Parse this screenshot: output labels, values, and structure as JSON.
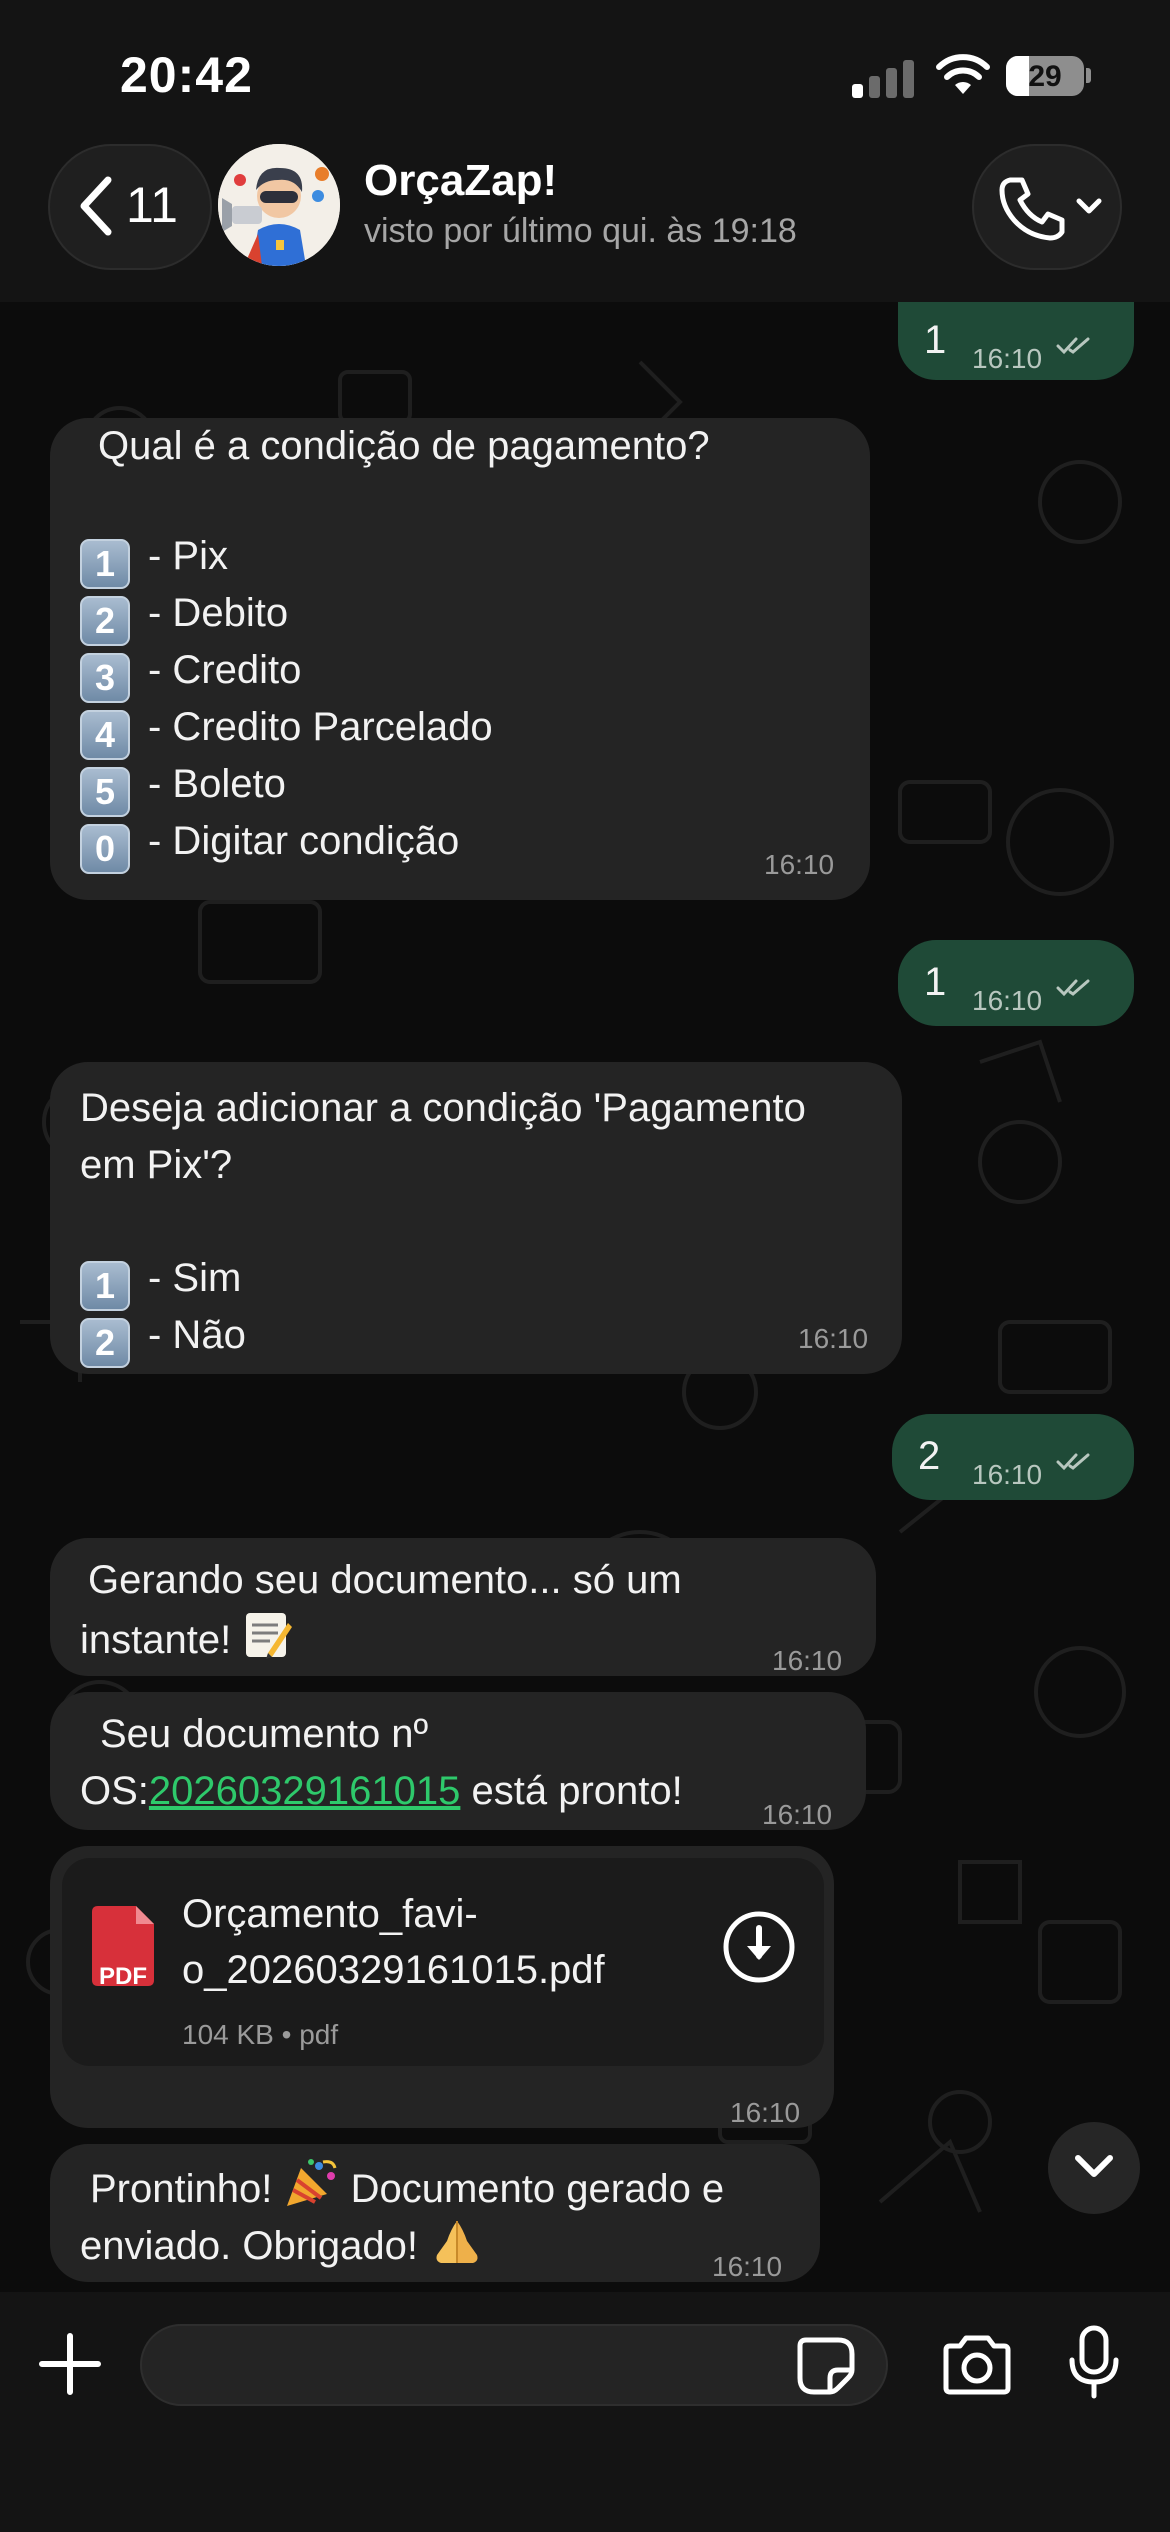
{
  "status_bar": {
    "time": "20:42",
    "battery": "29"
  },
  "header": {
    "back_count": "11",
    "contact_name": "OrçaZap!",
    "contact_status": "visto por último qui. às 19:18"
  },
  "messages": [
    {
      "dir": "out",
      "text": "1",
      "time": "16:10"
    },
    {
      "dir": "in",
      "question": "Qual é a condição de pagamento?",
      "options": [
        {
          "key": "1",
          "label": "- Pix"
        },
        {
          "key": "2",
          "label": "- Debito"
        },
        {
          "key": "3",
          "label": "- Credito"
        },
        {
          "key": "4",
          "label": "- Credito Parcelado"
        },
        {
          "key": "5",
          "label": "- Boleto"
        },
        {
          "key": "0",
          "label": "- Digitar condição"
        }
      ],
      "time": "16:10"
    },
    {
      "dir": "out",
      "text": "1",
      "time": "16:10"
    },
    {
      "dir": "in",
      "line1": "Deseja adicionar a condição 'Pagamento",
      "line2": "em Pix'?",
      "options": [
        {
          "key": "1",
          "label": "- Sim"
        },
        {
          "key": "2",
          "label": "- Não"
        }
      ],
      "time": "16:10"
    },
    {
      "dir": "out",
      "text": "2",
      "time": "16:10"
    },
    {
      "dir": "in",
      "line1": "Gerando seu documento... só um",
      "line2": "instante!",
      "time": "16:10"
    },
    {
      "dir": "in",
      "line1": "Seu documento nº",
      "line2_prefix": "OS:",
      "link": "20260329161015",
      "line2_suffix": " está pronto!",
      "time": "16:10"
    },
    {
      "dir": "in",
      "type": "document",
      "file_name_line1": "Orçamento_favi-",
      "file_name_line2": "o_20260329161015.pdf",
      "file_meta": "104 KB • pdf",
      "file_badge": "PDF",
      "time": "16:10"
    },
    {
      "dir": "in",
      "line1_a": "Prontinho!",
      "line1_b": "Documento gerado e",
      "line2": "enviado. Obrigado!",
      "time": "16:10"
    }
  ],
  "input": {
    "value": "",
    "placeholder": ""
  },
  "colors": {
    "incoming_bubble": "#242424",
    "outgoing_bubble": "#1f4a37",
    "link": "#2ec96b",
    "pdf_badge": "#d7303a"
  },
  "icons": [
    "back-chevron-icon",
    "phone-icon",
    "chevron-down-icon",
    "pdf-icon",
    "download-icon",
    "scroll-down-icon",
    "plus-icon",
    "sticker-icon",
    "camera-icon",
    "mic-icon"
  ]
}
